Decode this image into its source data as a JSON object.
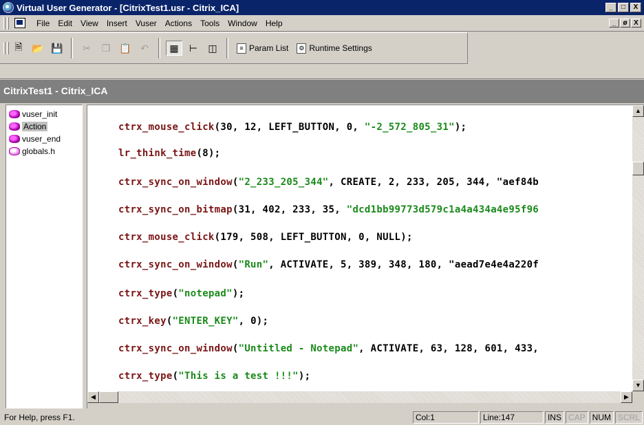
{
  "window": {
    "title": "Virtual User Generator - [CitrixTest1.usr - Citrix_ICA]",
    "controls": [
      "_",
      "□",
      "X"
    ]
  },
  "menubar": {
    "items": [
      {
        "label": "File"
      },
      {
        "label": "Edit"
      },
      {
        "label": "View"
      },
      {
        "label": "Insert"
      },
      {
        "label": "Vuser"
      },
      {
        "label": "Actions"
      },
      {
        "label": "Tools"
      },
      {
        "label": "Window"
      },
      {
        "label": "Help"
      }
    ],
    "mdi_controls": [
      "_",
      "ø",
      "X"
    ]
  },
  "toolbar": {
    "param_list_label": "Param List",
    "runtime_settings_label": "Runtime Settings"
  },
  "document": {
    "header": "CitrixTest1 - Citrix_ICA"
  },
  "tree": {
    "items": [
      {
        "label": "vuser_init"
      },
      {
        "label": "Action"
      },
      {
        "label": "vuser_end"
      },
      {
        "label": "globals.h"
      }
    ]
  },
  "code": {
    "lines": [
      {
        "fn": "ctrx_mouse_click",
        "pre": "(30, 12, LEFT_BUTTON, 0, ",
        "str": "\"-2_572_805_31\"",
        "post": ");"
      },
      {
        "fn": "lr_think_time",
        "pre": "(8);",
        "str": "",
        "post": ""
      },
      {
        "fn": "ctrx_sync_on_window",
        "pre": "(",
        "str": "\"2_233_205_344\"",
        "post": ", CREATE, 2, 233, 205, 344, \"aef84b"
      },
      {
        "fn": "ctrx_sync_on_bitmap",
        "pre": "(31, 402, 233, 35, ",
        "str": "\"dcd1bb99773d579c1a4a434a4e95f96",
        "post": ""
      },
      {
        "fn": "ctrx_mouse_click",
        "pre": "(179, 508, LEFT_BUTTON, 0, NULL);",
        "str": "",
        "post": ""
      },
      {
        "fn": "ctrx_sync_on_window",
        "pre": "(",
        "str": "\"Run\"",
        "post": ", ACTIVATE, 5, 389, 348, 180, \"aead7e4e4a220f"
      },
      {
        "fn": "ctrx_type",
        "pre": "(",
        "str": "\"notepad\"",
        "post": ");"
      },
      {
        "fn": "ctrx_key",
        "pre": "(",
        "str": "\"ENTER_KEY\"",
        "post": ", 0);"
      },
      {
        "fn": "ctrx_sync_on_window",
        "pre": "(",
        "str": "\"Untitled - Notepad\"",
        "post": ", ACTIVATE, 63, 128, 601, 433,"
      },
      {
        "fn": "ctrx_type",
        "pre": "(",
        "str": "\"This is a test !!!\"",
        "post": ");"
      }
    ]
  },
  "statusbar": {
    "help": "For Help, press F1.",
    "col": "Col:1",
    "line": "Line:147",
    "ins": "INS",
    "cap": "CAP",
    "num": "NUM",
    "scrl": "SCRL"
  },
  "colors": {
    "titlebar": "#0a246a",
    "function": "#7a1414",
    "string": "#1a8a1a",
    "header_bg": "#808080"
  }
}
